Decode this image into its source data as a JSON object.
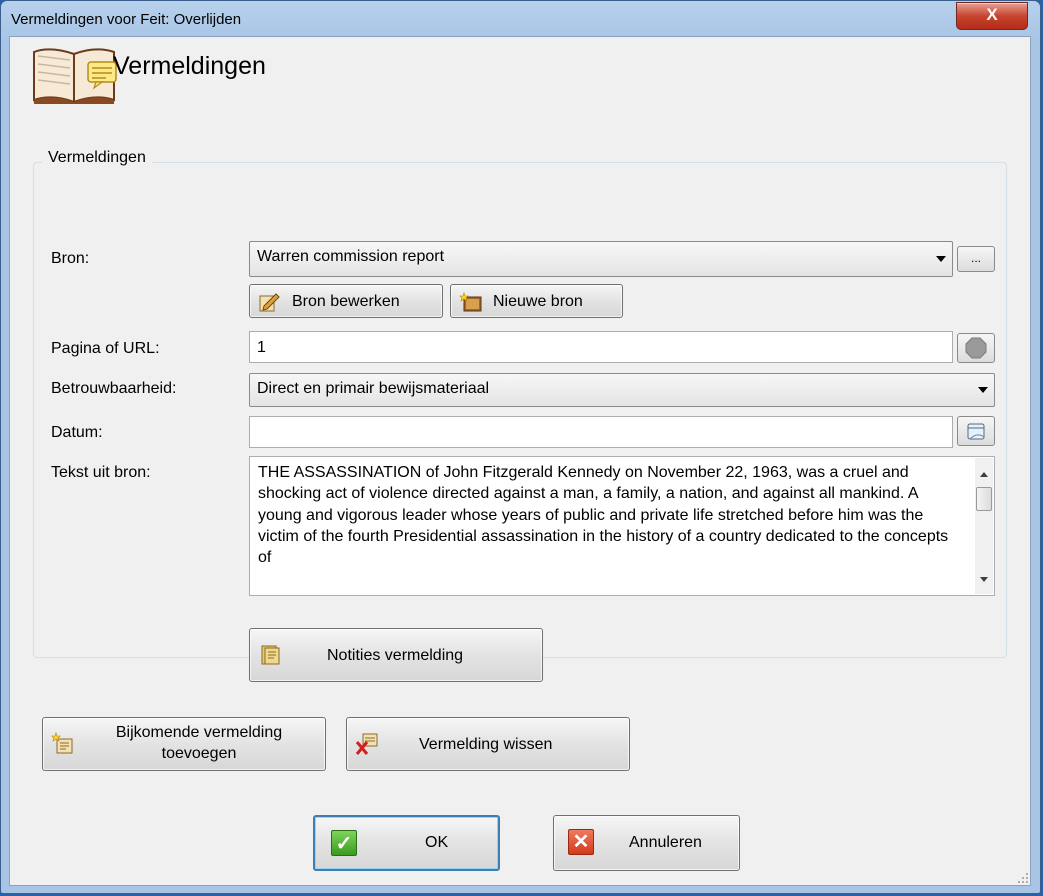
{
  "window": {
    "title": "Vermeldingen voor Feit: Overlijden",
    "close_label": "X"
  },
  "header": {
    "title": "Vermeldingen",
    "icon": "book-icon"
  },
  "group": {
    "title": "Vermeldingen"
  },
  "form": {
    "source_label": "Bron:",
    "source_value": "Warren commission report",
    "browse_label": "...",
    "edit_source_label": "Bron bewerken",
    "new_source_label": "Nieuwe bron",
    "page_label": "Pagina of URL:",
    "page_value": "1",
    "reliability_label": "Betrouwbaarheid:",
    "reliability_value": "Direct en primair bewijsmateriaal",
    "date_label": "Datum:",
    "date_value": "",
    "text_label": "Tekst uit bron:",
    "text_value": "THE ASSASSINATION of John Fitzgerald Kennedy on November 22, 1963, was a cruel and shocking act of violence directed against a man, a family, a nation, and against all mankind. A young and vigorous leader whose years of public and private life stretched before him was the victim of the fourth Presidential assassination in the history of a country dedicated to the concepts of",
    "notes_label": "Notities vermelding"
  },
  "actions": {
    "add_label": "Bijkomende vermelding toevoegen",
    "delete_label": "Vermelding wissen",
    "ok_label": "OK",
    "cancel_label": "Annuleren"
  },
  "colors": {
    "title_bar": "#a8c5e6",
    "close_button": "#c7442f",
    "ok_accent": "#3a9b1e",
    "cancel_accent": "#d23a1c",
    "focus_border": "#3c7fb1"
  }
}
